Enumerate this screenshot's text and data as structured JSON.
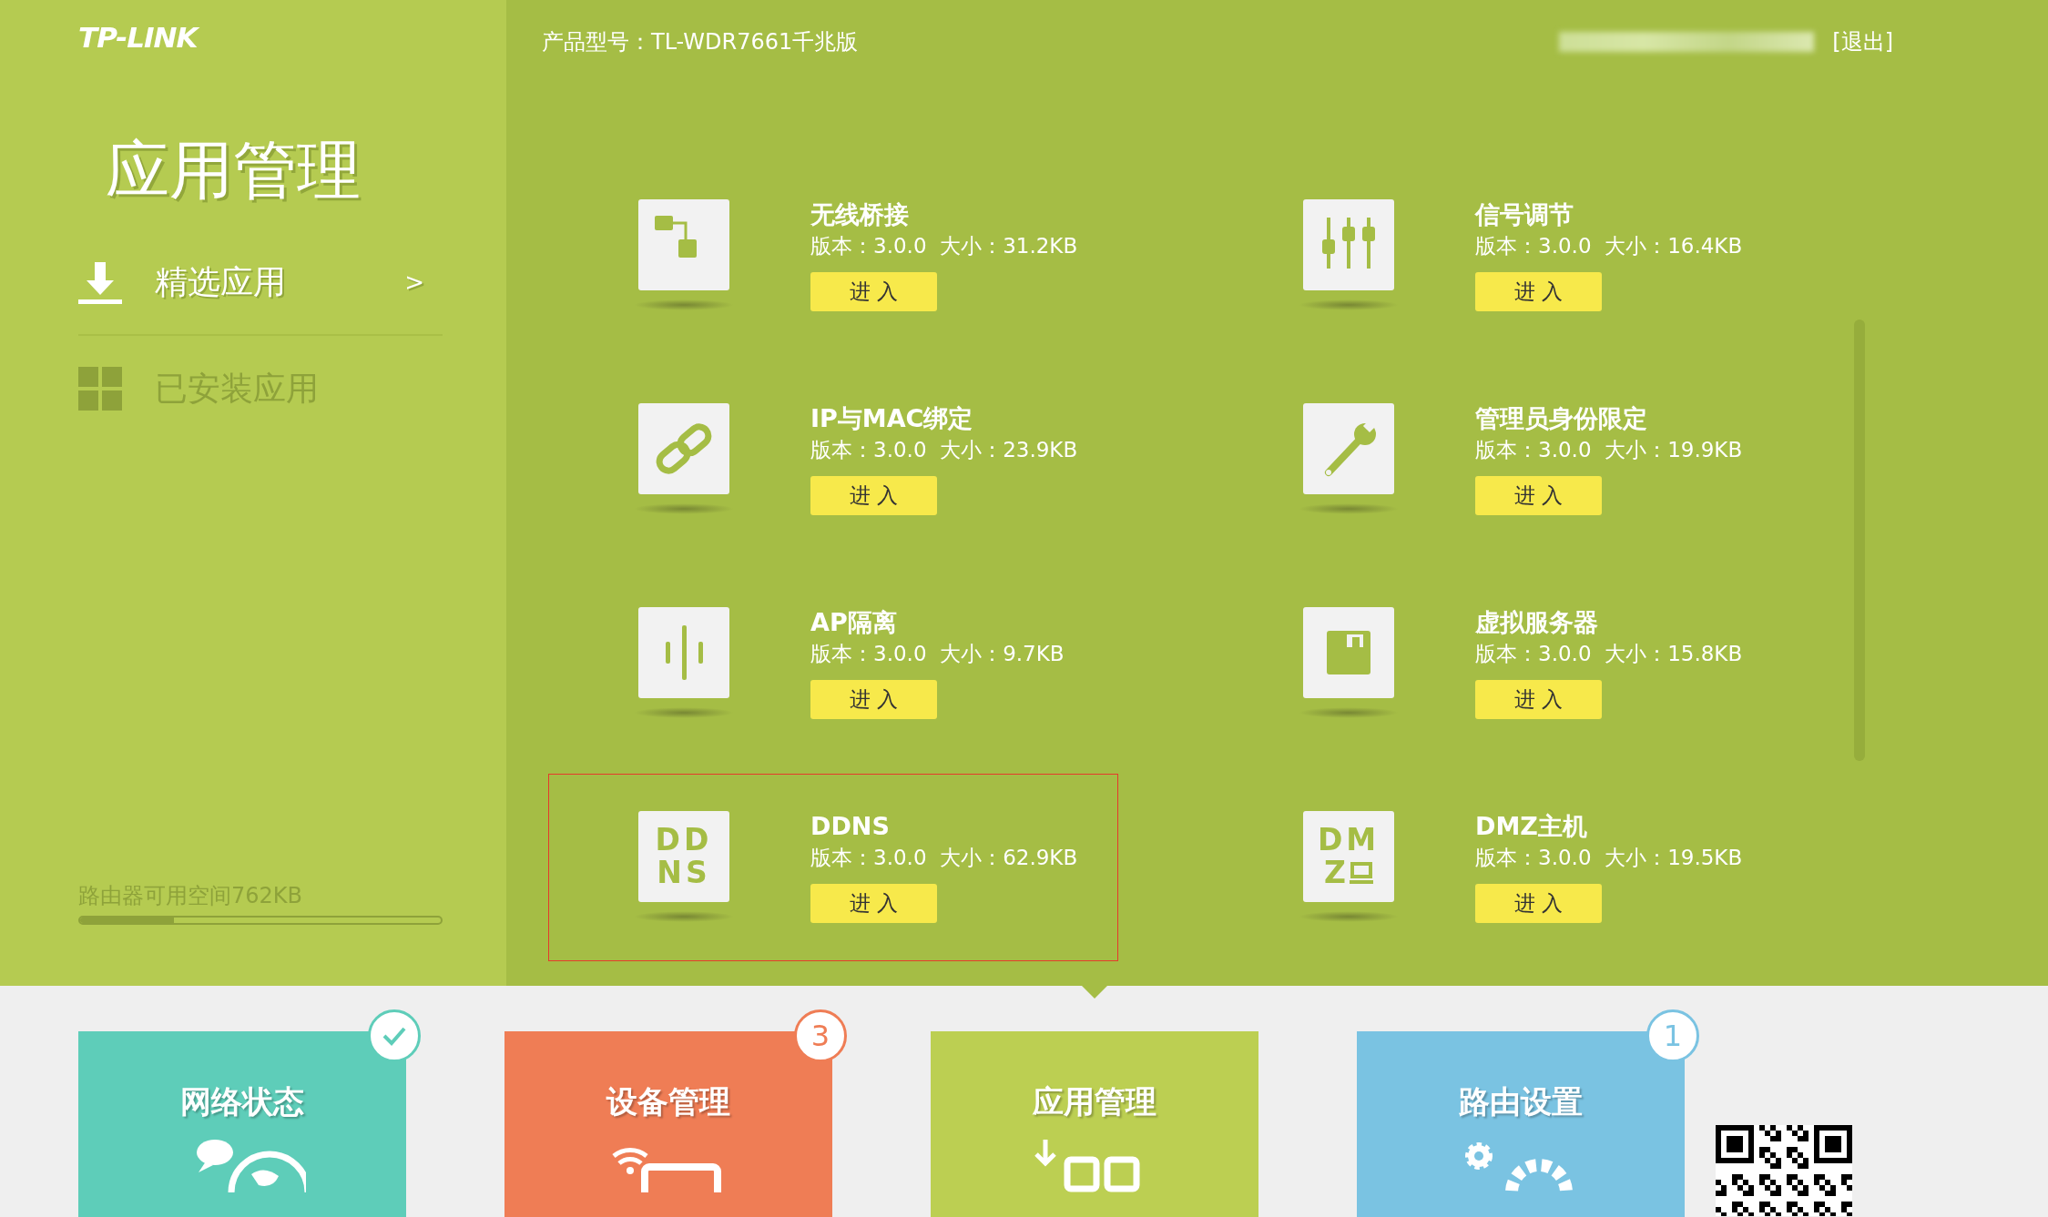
{
  "logo": "TP-LINK",
  "header": {
    "model": "产品型号：TL-WDR7661千兆版",
    "logout": "[退出]"
  },
  "sidebar": {
    "title": "应用管理",
    "items": [
      {
        "label": "精选应用",
        "kind": "download",
        "selected": true,
        "chevron": ">"
      },
      {
        "label": "已安装应用",
        "kind": "grid",
        "selected": false
      }
    ],
    "storage": {
      "label": "路由器可用空间762KB",
      "level": 0.26
    }
  },
  "apps": [
    {
      "name": "无线桥接",
      "meta": "版本：3.0.0  大小：31.2KB",
      "button": "进 入",
      "icon": {
        "kind": "bridge"
      },
      "selected": false
    },
    {
      "name": "信号调节",
      "meta": "版本：3.0.0  大小：16.4KB",
      "button": "进 入",
      "icon": {
        "kind": "sliders"
      },
      "selected": false
    },
    {
      "name": "IP与MAC绑定",
      "meta": "版本：3.0.0  大小：23.9KB",
      "button": "进 入",
      "icon": {
        "kind": "link"
      },
      "selected": false
    },
    {
      "name": "管理员身份限定",
      "meta": "版本：3.0.0  大小：19.9KB",
      "button": "进 入",
      "icon": {
        "kind": "wrench"
      },
      "selected": false
    },
    {
      "name": "AP隔离",
      "meta": "版本：3.0.0  大小：9.7KB",
      "button": "进 入",
      "icon": {
        "kind": "split"
      },
      "selected": false
    },
    {
      "name": "虚拟服务器",
      "meta": "版本：3.0.0  大小：15.8KB",
      "button": "进 入",
      "icon": {
        "kind": "floppy"
      },
      "selected": false
    },
    {
      "name": "DDNS",
      "meta": "版本：3.0.0  大小：62.9KB",
      "button": "进 入",
      "icon": {
        "kind": "letters",
        "lines": [
          "DD",
          "NS"
        ]
      },
      "selected": true
    },
    {
      "name": "DMZ主机",
      "meta": "版本：3.0.0  大小：19.5KB",
      "button": "进 入",
      "icon": {
        "kind": "letters-device",
        "lines": [
          "DM",
          "Z"
        ]
      },
      "selected": false
    }
  ],
  "nav_tiles": [
    {
      "label": "网络状态",
      "color": "#5ecdb9",
      "kind": "globe",
      "badge": {
        "kind": "check"
      },
      "selected": false
    },
    {
      "label": "设备管理",
      "color": "#ef7d55",
      "kind": "device",
      "badge": {
        "kind": "count",
        "text": "3"
      },
      "selected": false
    },
    {
      "label": "应用管理",
      "color": "#bccf52",
      "kind": "apps",
      "selected": true
    },
    {
      "label": "路由设置",
      "color": "#7ac3e2",
      "kind": "gears",
      "badge": {
        "kind": "count",
        "text": "1"
      },
      "selected": false
    }
  ]
}
